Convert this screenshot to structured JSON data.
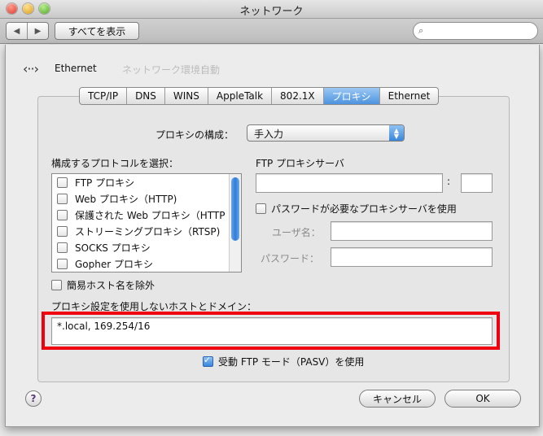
{
  "window": {
    "title": "ネットワーク"
  },
  "toolbar": {
    "back_label": "◀",
    "forward_label": "▶",
    "show_all_label": "すべてを表示",
    "search_placeholder": ""
  },
  "background": {
    "ghost_location": "ネットワーク環境：",
    "ghost_auto": "自動"
  },
  "interface": {
    "name": "Ethernet"
  },
  "tabs": [
    "TCP/IP",
    "DNS",
    "WINS",
    "AppleTalk",
    "802.1X",
    "プロキシ",
    "Ethernet"
  ],
  "active_tab": "プロキシ",
  "proxy_config": {
    "label": "プロキシの構成：",
    "value": "手入力"
  },
  "protocols": {
    "label": "構成するプロトコルを選択：",
    "items": [
      {
        "label": "FTP プロキシ",
        "checked": false
      },
      {
        "label": "Web プロキシ（HTTP)",
        "checked": false
      },
      {
        "label": "保護された Web プロキシ（HTTP",
        "checked": false
      },
      {
        "label": "ストリーミングプロキシ（RTSP)",
        "checked": false
      },
      {
        "label": "SOCKS プロキシ",
        "checked": false
      },
      {
        "label": "Gopher プロキシ",
        "checked": false
      }
    ]
  },
  "ftp_proxy": {
    "label": "FTP プロキシサーバ",
    "server": "",
    "colon": ":",
    "port": ""
  },
  "password_required": {
    "label": "パスワードが必要なプロキシサーバを使用",
    "checked": false
  },
  "username": {
    "label": "ユーザ名：",
    "value": ""
  },
  "password": {
    "label": "パスワード：",
    "value": ""
  },
  "exclude_simple": {
    "label": "簡易ホスト名を除外",
    "checked": false
  },
  "bypass": {
    "label": "プロキシ設定を使用しないホストとドメイン：",
    "value": "*.local, 169.254/16"
  },
  "passive_ftp": {
    "label": "受動 FTP モード（PASV）を使用",
    "checked": true
  },
  "buttons": {
    "help": "?",
    "cancel": "キャンセル",
    "ok": "OK"
  }
}
